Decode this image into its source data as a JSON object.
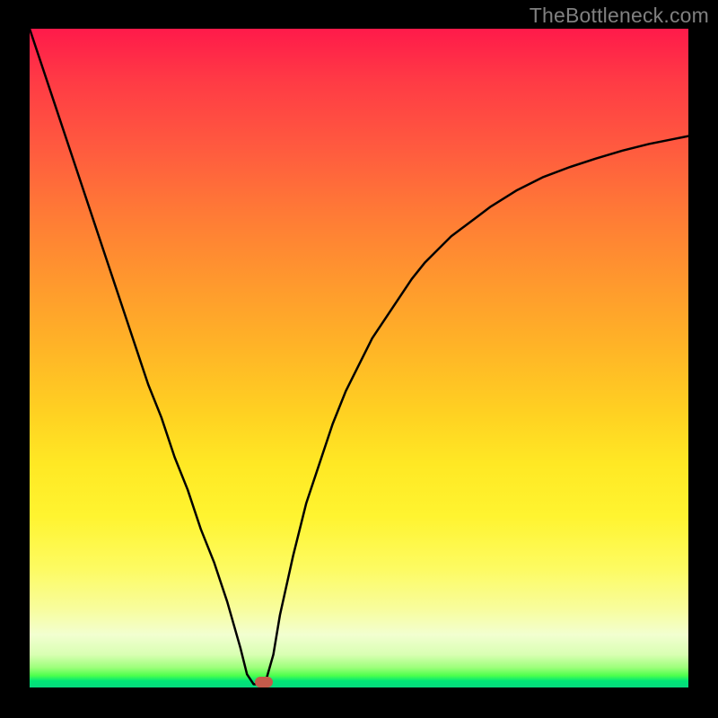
{
  "watermark": {
    "text": "TheBottleneck.com"
  },
  "colors": {
    "curve_stroke": "#000000",
    "marker_fill": "#c55a4a",
    "frame_bg": "#000000"
  },
  "chart_data": {
    "type": "line",
    "title": "",
    "xlabel": "",
    "ylabel": "",
    "xlim": [
      0,
      100
    ],
    "ylim": [
      0,
      100
    ],
    "grid": false,
    "legend": false,
    "series": [
      {
        "name": "curve",
        "x": [
          0,
          2,
          4,
          6,
          8,
          10,
          12,
          14,
          16,
          18,
          20,
          22,
          24,
          26,
          28,
          30,
          32,
          33,
          34,
          35,
          35.5,
          36,
          37,
          38,
          40,
          42,
          44,
          46,
          48,
          50,
          52,
          54,
          56,
          58,
          60,
          62,
          64,
          66,
          68,
          70,
          74,
          78,
          82,
          86,
          90,
          94,
          98,
          100
        ],
        "y": [
          100,
          94,
          88,
          82,
          76,
          70,
          64,
          58,
          52,
          46,
          41,
          35,
          30,
          24,
          19,
          13,
          6,
          2,
          0.5,
          0.5,
          0.5,
          1.5,
          5,
          11,
          20,
          28,
          34,
          40,
          45,
          49,
          53,
          56,
          59,
          62,
          64.5,
          66.5,
          68.5,
          70,
          71.5,
          73,
          75.5,
          77.5,
          79,
          80.3,
          81.5,
          82.5,
          83.3,
          83.7
        ]
      }
    ],
    "marker": {
      "x": 35.5,
      "y": 0.8
    }
  }
}
